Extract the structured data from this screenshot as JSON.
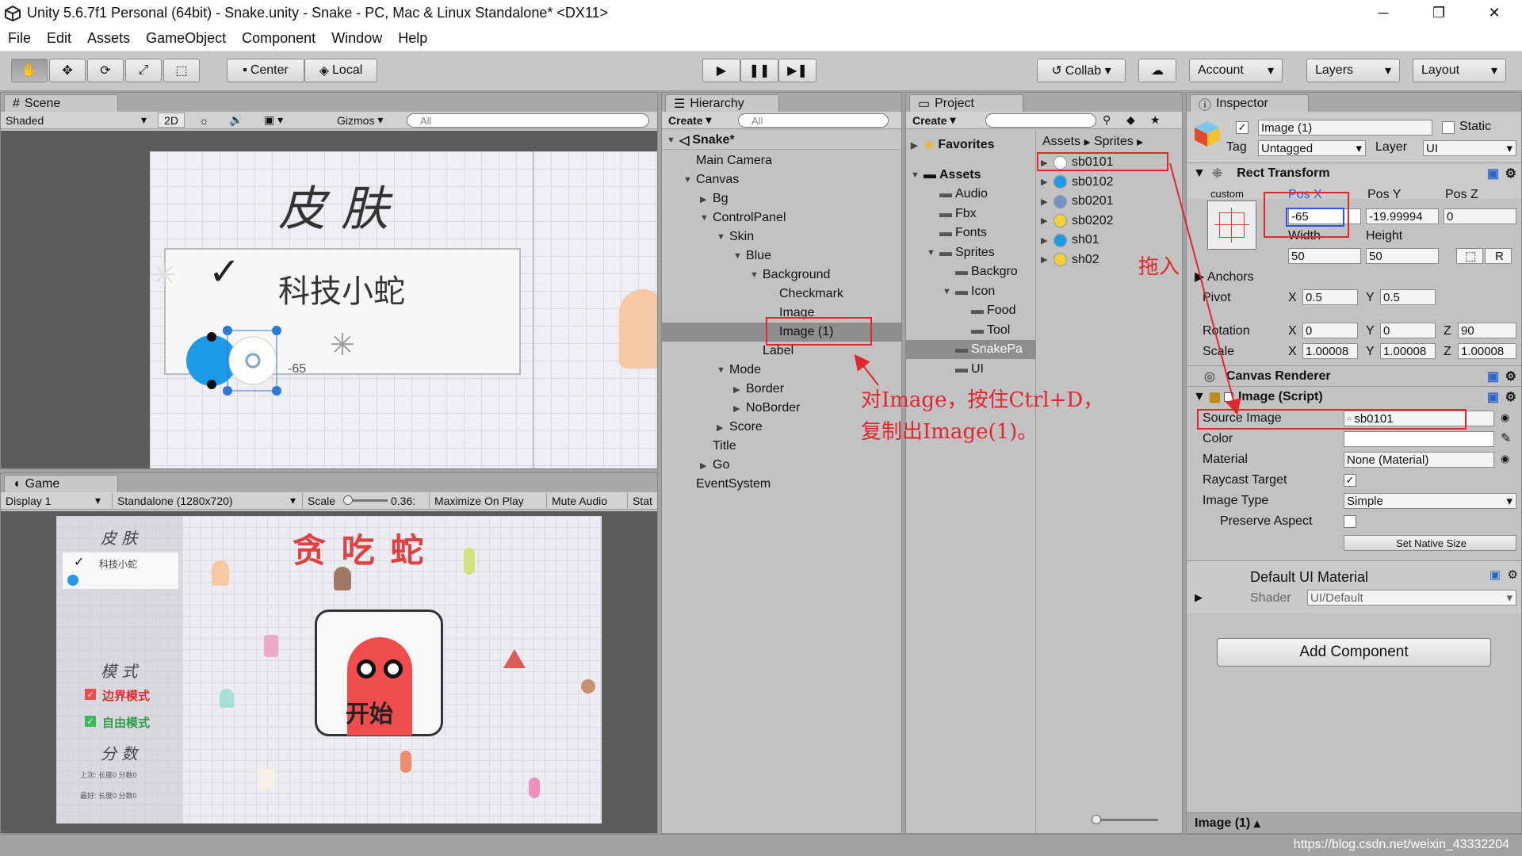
{
  "window": {
    "title": "Unity 5.6.7f1 Personal (64bit) - Snake.unity - Snake - PC, Mac & Linux Standalone* <DX11>",
    "minimize": "─",
    "maximize": "❐",
    "close": "✕"
  },
  "menu": [
    "File",
    "Edit",
    "Assets",
    "GameObject",
    "Component",
    "Window",
    "Help"
  ],
  "toolbar": {
    "pivot": "Center",
    "space": "Local",
    "collab": "Collab ▾",
    "account": "Account",
    "layers": "Layers",
    "layout": "Layout"
  },
  "scene": {
    "tab": "Scene",
    "shading": "Shaded",
    "mode2d": "2D",
    "gizmos": "Gizmos",
    "search": "All",
    "skin_title": "皮 肤",
    "skin_item": "科技小蛇",
    "pos_label": "-65"
  },
  "game": {
    "tab": "Game",
    "display": "Display 1",
    "resolution": "Standalone (1280x720)",
    "scale_label": "Scale",
    "scale_value": "0.36:",
    "maximize": "Maximize On Play",
    "mute": "Mute Audio",
    "stats": "Stat",
    "skin_title": "皮 肤",
    "skin_item": "科技小蛇",
    "game_title": "贪 吃 蛇",
    "start": "开始",
    "mode_title": "模 式",
    "mode_border": "边界模式",
    "mode_free": "自由模式",
    "score_title": "分 数",
    "score_row1": "上次: 长度0  分数0",
    "score_row2": "最好: 长度0  分数0"
  },
  "hierarchy": {
    "tab": "Hierarchy",
    "create": "Create",
    "search": "All",
    "root": "Snake*",
    "items": [
      {
        "label": "Main Camera",
        "depth": 1,
        "arrow": ""
      },
      {
        "label": "Canvas",
        "depth": 1,
        "arrow": "▼"
      },
      {
        "label": "Bg",
        "depth": 2,
        "arrow": "▶"
      },
      {
        "label": "ControlPanel",
        "depth": 2,
        "arrow": "▼"
      },
      {
        "label": "Skin",
        "depth": 3,
        "arrow": "▼"
      },
      {
        "label": "Blue",
        "depth": 4,
        "arrow": "▼"
      },
      {
        "label": "Background",
        "depth": 5,
        "arrow": "▼"
      },
      {
        "label": "Checkmark",
        "depth": 6,
        "arrow": ""
      },
      {
        "label": "Image",
        "depth": 6,
        "arrow": ""
      },
      {
        "label": "Image (1)",
        "depth": 6,
        "arrow": "",
        "selected": true
      },
      {
        "label": "Label",
        "depth": 5,
        "arrow": ""
      },
      {
        "label": "Mode",
        "depth": 3,
        "arrow": "▼"
      },
      {
        "label": "Border",
        "depth": 4,
        "arrow": "▶"
      },
      {
        "label": "NoBorder",
        "depth": 4,
        "arrow": "▶"
      },
      {
        "label": "Score",
        "depth": 3,
        "arrow": "▶"
      },
      {
        "label": "Title",
        "depth": 2,
        "arrow": ""
      },
      {
        "label": "Go",
        "depth": 2,
        "arrow": "▶"
      },
      {
        "label": "EventSystem",
        "depth": 1,
        "arrow": ""
      }
    ]
  },
  "project": {
    "tab": "Project",
    "create": "Create",
    "favorites": "Favorites",
    "assets": "Assets",
    "folders": [
      {
        "label": "Audio",
        "depth": 1,
        "arrow": ""
      },
      {
        "label": "Fbx",
        "depth": 1,
        "arrow": ""
      },
      {
        "label": "Fonts",
        "depth": 1,
        "arrow": ""
      },
      {
        "label": "Sprites",
        "depth": 1,
        "arrow": "▼"
      },
      {
        "label": "Backgro",
        "depth": 2,
        "arrow": ""
      },
      {
        "label": "Icon",
        "depth": 2,
        "arrow": "▼"
      },
      {
        "label": "Food",
        "depth": 3,
        "arrow": ""
      },
      {
        "label": "Tool",
        "depth": 3,
        "arrow": ""
      },
      {
        "label": "SnakePa",
        "depth": 2,
        "arrow": "",
        "selected": true
      },
      {
        "label": "UI",
        "depth": 2,
        "arrow": ""
      }
    ],
    "breadcrumb_root": "Assets",
    "breadcrumb_leaf": "Sprites",
    "sprites": [
      {
        "label": "sb0101",
        "color": "#ffffff"
      },
      {
        "label": "sb0102",
        "color": "#1e9be8"
      },
      {
        "label": "sb0201",
        "color": "#6f95cc"
      },
      {
        "label": "sb0202",
        "color": "#f1cf3a"
      },
      {
        "label": "sh01",
        "color": "#1e9be8"
      },
      {
        "label": "sh02",
        "color": "#f1cf3a"
      }
    ]
  },
  "inspector": {
    "tab": "Inspector",
    "name": "Image (1)",
    "static": "Static",
    "tag_label": "Tag",
    "tag": "Untagged",
    "layer_label": "Layer",
    "layer": "UI",
    "rect_transform": "Rect Transform",
    "custom": "custom",
    "posx_label": "Pos X",
    "posy_label": "Pos Y",
    "posz_label": "Pos Z",
    "posx": "-65",
    "posy": "-19.99994",
    "posz": "0",
    "width_label": "Width",
    "height_label": "Height",
    "width": "50",
    "height": "50",
    "r_btn": "R",
    "anchors": "Anchors",
    "pivot": "Pivot",
    "pivot_x": "0.5",
    "pivot_y": "0.5",
    "rotation": "Rotation",
    "rot_x": "0",
    "rot_y": "0",
    "rot_z": "90",
    "scale": "Scale",
    "scale_x": "1.00008",
    "scale_y": "1.00008",
    "scale_z": "1.00008",
    "canvas_renderer": "Canvas Renderer",
    "image_script": "Image (Script)",
    "source_image_label": "Source Image",
    "source_image": "sb0101",
    "color_label": "Color",
    "material_label": "Material",
    "material": "None (Material)",
    "raycast_label": "Raycast Target",
    "image_type_label": "Image Type",
    "image_type": "Simple",
    "preserve_label": "Preserve Aspect",
    "native_size": "Set Native Size",
    "default_material": "Default UI Material",
    "shader_label": "Shader",
    "shader": "UI/Default",
    "add_component": "Add Component",
    "footer": "Image (1)"
  },
  "annotations": {
    "drag": "拖入",
    "dup_line1": "对Image，按住Ctrl+D，",
    "dup_line2": "复制出Image(1)。"
  },
  "watermark": "https://blog.csdn.net/weixin_43332204",
  "colors": {
    "annotation": "#e0262e",
    "selected": "#8e8e8e",
    "blue_box": "#2d52e6",
    "snake_blue": "#1e9be8",
    "snake_red": "#ef4d4d"
  }
}
